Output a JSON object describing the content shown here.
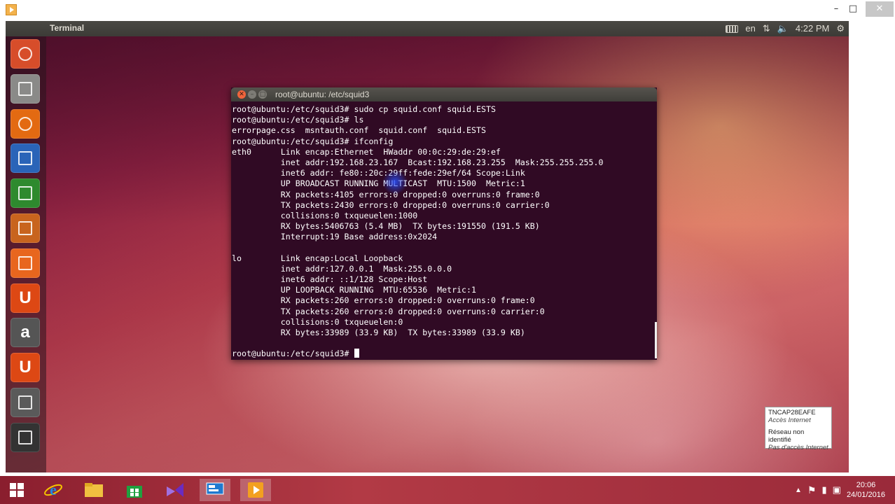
{
  "panel": {
    "title": "Terminal",
    "keyboard_layout": "en",
    "time": "4:22 PM"
  },
  "terminal": {
    "title": "root@ubuntu: /etc/squid3",
    "lines": [
      "root@ubuntu:/etc/squid3# sudo cp squid.conf squid.ESTS",
      "root@ubuntu:/etc/squid3# ls",
      "errorpage.css  msntauth.conf  squid.conf  squid.ESTS",
      "root@ubuntu:/etc/squid3# ifconfig",
      "eth0      Link encap:Ethernet  HWaddr 00:0c:29:de:29:ef  ",
      "          inet addr:192.168.23.167  Bcast:192.168.23.255  Mask:255.255.255.0",
      "          inet6 addr: fe80::20c:29ff:fede:29ef/64 Scope:Link",
      "          UP BROADCAST RUNNING MULTICAST  MTU:1500  Metric:1",
      "          RX packets:4105 errors:0 dropped:0 overruns:0 frame:0",
      "          TX packets:2430 errors:0 dropped:0 overruns:0 carrier:0",
      "          collisions:0 txqueuelen:1000 ",
      "          RX bytes:5406763 (5.4 MB)  TX bytes:191550 (191.5 KB)",
      "          Interrupt:19 Base address:0x2024 ",
      "",
      "lo        Link encap:Local Loopback  ",
      "          inet addr:127.0.0.1  Mask:255.0.0.0",
      "          inet6 addr: ::1/128 Scope:Host",
      "          UP LOOPBACK RUNNING  MTU:65536  Metric:1",
      "          RX packets:260 errors:0 dropped:0 overruns:0 frame:0",
      "          TX packets:260 errors:0 dropped:0 overruns:0 carrier:0",
      "          collisions:0 txqueuelen:0 ",
      "          RX bytes:33989 (33.9 KB)  TX bytes:33989 (33.9 KB)",
      ""
    ],
    "prompt": "root@ubuntu:/etc/squid3# "
  },
  "launcher": {
    "items": [
      {
        "name": "ubuntu-dash",
        "icon": "ubuntu-logo-icon",
        "color": "#d74d2a"
      },
      {
        "name": "files",
        "icon": "file-cabinet-icon",
        "color": "#8a8a88"
      },
      {
        "name": "firefox",
        "icon": "firefox-icon",
        "color": "#e36a12"
      },
      {
        "name": "writer",
        "icon": "document-icon",
        "color": "#2a64b8"
      },
      {
        "name": "calc",
        "icon": "spreadsheet-icon",
        "color": "#2e8a2e"
      },
      {
        "name": "impress",
        "icon": "presentation-icon",
        "color": "#c8641e"
      },
      {
        "name": "software-center",
        "icon": "shopping-bag-icon",
        "color": "#e8661e"
      },
      {
        "name": "ubuntu-one",
        "icon": "ubuntu-one-icon",
        "color": "#dd4814"
      },
      {
        "name": "amazon",
        "icon": "amazon-icon",
        "color": "#555555"
      },
      {
        "name": "ubuntu-one-music",
        "icon": "ubuntu-one-music-icon",
        "color": "#dd4814"
      },
      {
        "name": "system-settings",
        "icon": "gear-wrench-icon",
        "color": "#5a5a5a"
      },
      {
        "name": "terminal",
        "icon": "terminal-icon",
        "color": "#333333"
      }
    ],
    "glyphs": {
      "ubuntu-one": "U",
      "amazon": "a",
      "ubuntu-one-music": "U"
    }
  },
  "network_popup": {
    "ssid": "TNCAP28EAFE",
    "ssid_status": "Accès Internet",
    "network": "Réseau non identifié",
    "network_status": "Pas d'accès Internet"
  },
  "taskbar": {
    "clock_time": "20:06",
    "clock_date": "24/01/2016",
    "items": [
      "windows-start-icon",
      "internet-explorer-icon",
      "file-explorer-icon",
      "store-icon",
      "visual-studio-icon",
      "remote-desktop-icon",
      "media-player-icon"
    ]
  }
}
